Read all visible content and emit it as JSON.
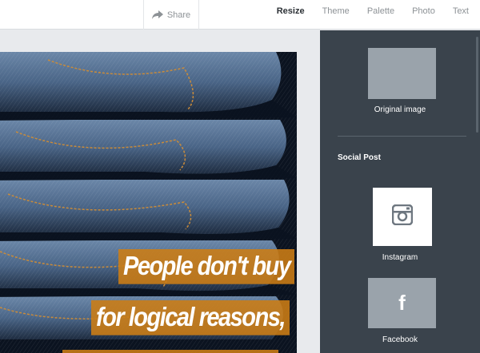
{
  "toolbar": {
    "share_label": "Share",
    "share_icon": "share-arrow-icon",
    "tabs": [
      {
        "label": "Resize",
        "active": true
      },
      {
        "label": "Theme",
        "active": false
      },
      {
        "label": "Palette",
        "active": false
      },
      {
        "label": "Photo",
        "active": false
      },
      {
        "label": "Text",
        "active": false
      }
    ]
  },
  "artwork": {
    "quote_lines": [
      "People don't buy",
      "for logical reasons,"
    ],
    "highlight_color": "#cd7d14"
  },
  "resize_panel": {
    "original_label": "Original image",
    "section_title": "Social Post",
    "sizes": [
      {
        "label": "Instagram",
        "icon": "instagram-icon"
      },
      {
        "label": "Facebook",
        "icon": "facebook-icon",
        "glyph": "f"
      }
    ]
  }
}
